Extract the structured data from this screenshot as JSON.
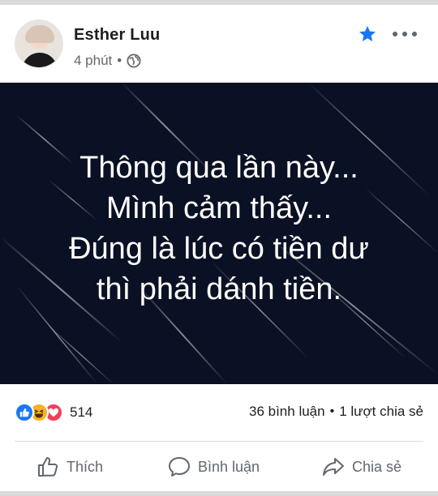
{
  "post": {
    "author": "Esther Luu",
    "time": "4 phút",
    "separator": "•",
    "icons": {
      "privacy": "globe-icon",
      "favorite": "star-icon",
      "menu": "more-icon"
    },
    "accent_color": "#1877f2"
  },
  "image": {
    "background_color": "#0b1124",
    "lines": [
      "Thông qua lần này...",
      "Mình cảm thấy...",
      "Đúng là lúc có tiền dư",
      "thì phải dánh tiền."
    ]
  },
  "stats": {
    "reactions": [
      "like",
      "haha",
      "love"
    ],
    "reaction_count": "514",
    "comments": "36 bình luận",
    "dot": "•",
    "shares": "1 lượt chia sẻ"
  },
  "actions": {
    "like_label": "Thích",
    "comment_label": "Bình luận",
    "share_label": "Chia sẻ"
  }
}
